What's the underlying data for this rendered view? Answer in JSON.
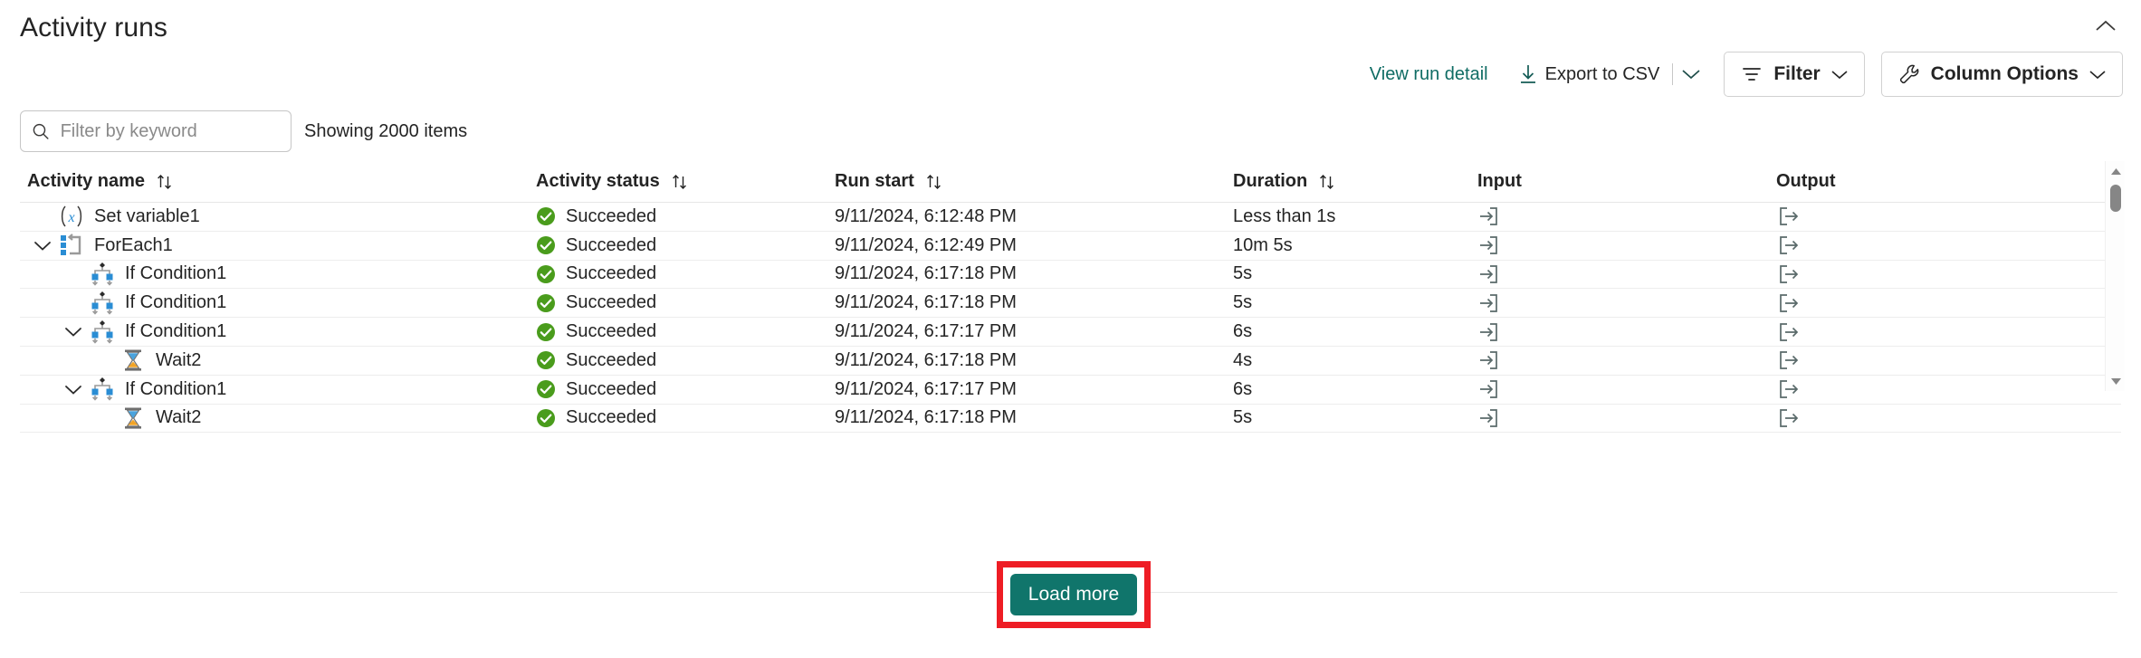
{
  "panel": {
    "title": "Activity runs",
    "collapse_icon": "chevron-up-icon"
  },
  "toolbar": {
    "view_run_detail": "View run detail",
    "export_csv": "Export to CSV",
    "export_icon": "download-icon",
    "export_chevron_icon": "chevron-down-icon",
    "filter": "Filter",
    "filter_icon": "filter-icon",
    "filter_chevron_icon": "chevron-down-icon",
    "column_options": "Column Options",
    "column_options_icon": "wrench-icon",
    "column_options_chevron_icon": "chevron-down-icon"
  },
  "search": {
    "placeholder": "Filter by keyword",
    "value": "",
    "icon": "search-icon"
  },
  "status_text": "Showing 2000 items",
  "table": {
    "columns": [
      {
        "label": "Activity name",
        "sortable": true,
        "sort_icon": "sort-arrows-icon"
      },
      {
        "label": "Activity status",
        "sortable": true,
        "sort_icon": "sort-arrows-icon"
      },
      {
        "label": "Run start",
        "sortable": true,
        "sort_icon": "sort-arrows-icon"
      },
      {
        "label": "Duration",
        "sortable": true,
        "sort_icon": "sort-arrows-icon"
      },
      {
        "label": "Input",
        "sortable": false,
        "sort_icon": ""
      },
      {
        "label": "Output",
        "sortable": false,
        "sort_icon": ""
      }
    ],
    "rows": [
      {
        "name": "Set variable1",
        "icon": "set-variable-icon",
        "indent": 0,
        "expander": "none",
        "status": "Succeeded",
        "status_icon": "success-check-icon",
        "run_start": "9/11/2024, 6:12:48 PM",
        "duration": "Less than 1s",
        "input_icon": "input-arrow-icon",
        "output_icon": "output-arrow-icon"
      },
      {
        "name": "ForEach1",
        "icon": "foreach-loop-icon",
        "indent": 0,
        "expander": "expanded",
        "status": "Succeeded",
        "status_icon": "success-check-icon",
        "run_start": "9/11/2024, 6:12:49 PM",
        "duration": "10m 5s",
        "input_icon": "input-arrow-icon",
        "output_icon": "output-arrow-icon"
      },
      {
        "name": "If Condition1",
        "icon": "if-condition-icon",
        "indent": 1,
        "expander": "none",
        "status": "Succeeded",
        "status_icon": "success-check-icon",
        "run_start": "9/11/2024, 6:17:18 PM",
        "duration": "5s",
        "input_icon": "input-arrow-icon",
        "output_icon": "output-arrow-icon"
      },
      {
        "name": "If Condition1",
        "icon": "if-condition-icon",
        "indent": 1,
        "expander": "none",
        "status": "Succeeded",
        "status_icon": "success-check-icon",
        "run_start": "9/11/2024, 6:17:18 PM",
        "duration": "5s",
        "input_icon": "input-arrow-icon",
        "output_icon": "output-arrow-icon"
      },
      {
        "name": "If Condition1",
        "icon": "if-condition-icon",
        "indent": 1,
        "expander": "expanded",
        "status": "Succeeded",
        "status_icon": "success-check-icon",
        "run_start": "9/11/2024, 6:17:17 PM",
        "duration": "6s",
        "input_icon": "input-arrow-icon",
        "output_icon": "output-arrow-icon"
      },
      {
        "name": "Wait2",
        "icon": "wait-hourglass-icon",
        "indent": 2,
        "expander": "none",
        "status": "Succeeded",
        "status_icon": "success-check-icon",
        "run_start": "9/11/2024, 6:17:18 PM",
        "duration": "4s",
        "input_icon": "input-arrow-icon",
        "output_icon": "output-arrow-icon"
      },
      {
        "name": "If Condition1",
        "icon": "if-condition-icon",
        "indent": 1,
        "expander": "expanded",
        "status": "Succeeded",
        "status_icon": "success-check-icon",
        "run_start": "9/11/2024, 6:17:17 PM",
        "duration": "6s",
        "input_icon": "input-arrow-icon",
        "output_icon": "output-arrow-icon"
      },
      {
        "name": "Wait2",
        "icon": "wait-hourglass-icon",
        "indent": 2,
        "expander": "none",
        "status": "Succeeded",
        "status_icon": "success-check-icon",
        "run_start": "9/11/2024, 6:17:18 PM",
        "duration": "5s",
        "input_icon": "input-arrow-icon",
        "output_icon": "output-arrow-icon"
      }
    ]
  },
  "footer": {
    "load_more": "Load more"
  },
  "colors": {
    "accent_teal": "#10756b",
    "link_teal": "#0f6c64",
    "success_green": "#4a9c1c",
    "highlight_red": "#ee1d25",
    "icon_blue": "#2a8dd4"
  }
}
